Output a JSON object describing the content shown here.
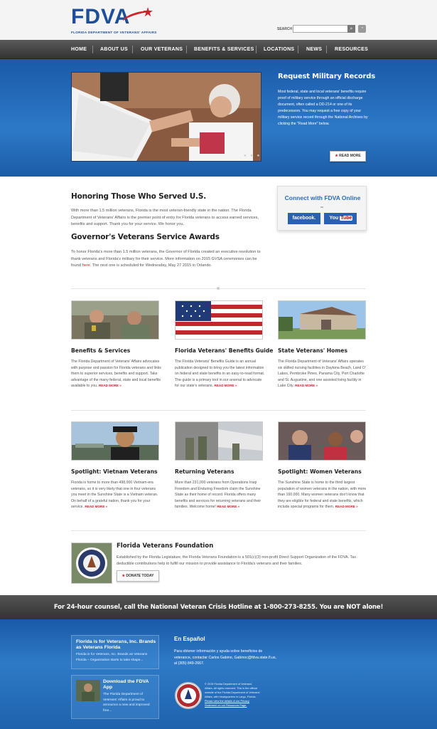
{
  "header": {
    "logo_text": "FDVA",
    "logo_subtitle": "FLORIDA DEPARTMENT OF VETERANS' AFFAIRS",
    "search_label": "SEARCH",
    "search_value": ""
  },
  "nav": [
    "HOME",
    "ABOUT US",
    "OUR VETERANS",
    "BENEFITS & SERVICES",
    "LOCATIONS",
    "NEWS",
    "RESOURCES"
  ],
  "hero": {
    "title": "Request Military Records",
    "text": "Most federal, state and local veterans' benefits require proof of military service through an official discharge document, often called a DD-214 or one of its predecessors. You may request a free copy of your military service record through the National Archives by clicking the \"Read More\" below.",
    "read_more": "READ MORE",
    "slider_dots": "● ● ●"
  },
  "intro": {
    "title": "Honoring Those Who Served U.S.",
    "text": "With more than 1.5 million veterans, Florida is the most veteran-friendly state in the nation. The Florida Department of Veterans' Affairs is the premier point of entry for Florida veterans to access earned services, benefits and support. Thank you for your service. We honor you.",
    "awards_title": "Governor's Veterans Service Awards",
    "awards_text_1": "To honor Florida's more than 1.5 million veterans, the Governor of Florida created an executive resolution to thank veterans and Florida's military for their service. More information on 2015 GVSA ceremonies can be found ",
    "awards_link": "here",
    "awards_text_2": ". The next one is scheduled for Wednesday, May 27 2015 in Orlando."
  },
  "connect": {
    "title": "Connect with FDVA Online",
    "facebook": "facebook.",
    "youtube_1": "You",
    "youtube_2": "Tube"
  },
  "cards_row1": [
    {
      "title": "Benefits & Services",
      "text": "The Florida Department of Veterans' Affairs advocates with purpose and passion for Florida veterans and links them to superior services, benefits and support. Take advantage of the many federal, state and local benefits available to you.",
      "link": "READ MORE »"
    },
    {
      "title": "Florida Veterans' Benefits Guide",
      "text": "The Florida Veterans' Benefits Guide is an annual publication designed to bring you the latest information on federal and state benefits in an easy-to-read format. The guide is a primary tool in our arsenal to advocate for our state's veterans.",
      "link": "READ MORE »"
    },
    {
      "title": "State Veterans' Homes",
      "text": "The Florida Department of Veterans' Affairs operates six skilled nursing facilities in Daytona Beach, Land O' Lakes, Pembroke Pines, Panama City, Port Charlotte and St. Augustine, and one assisted living facility in Lake City.",
      "link": "READ MORE »"
    }
  ],
  "cards_row2": [
    {
      "title": "Spotlight: Vietnam Veterans",
      "text": "Florida is home to more than 498,000 Vietnam-era veterans, so it is very likely that one in four veterans you meet in the Sunshine State is a Vietnam veteran. On behalf of a grateful nation, thank you for your service.",
      "link": "READ MORE »"
    },
    {
      "title": "Returning Veterans",
      "text": "More than 231,000 veterans from Operations Iraqi Freedom and Enduring Freedom claim the Sunshine State as their home of record. Florida offers many benefits and services for returning veterans and their families. Welcome home!",
      "link": "READ MORE »"
    },
    {
      "title": "Spotlight: Women Veterans",
      "text": "The Sunshine State is home to the third largest population of women veterans in the nation, with more than 160,000. Many women veterans don't know that they are eligible for federal and state benefits, which include special programs for them.",
      "link": "READ MORE »"
    }
  ],
  "foundation": {
    "title": "Florida Veterans Foundation",
    "text": "Established by the Florida Legislature, the Florida Veterans Foundation is a 501(c)(3) non-profit Direct Support Organization of the FDVA. Tax deductible contributions help to fulfill our mission to provide assistance to Florida's veterans and their families.",
    "donate": "DONATE TODAY"
  },
  "crisis_text": "For 24-hour counsel, call the National Veteran Crisis Hotline at 1-800-273-8255. You are NOT alone!",
  "footer": {
    "box1_title": "Florida is for Veterans, Inc. Brands as Veterans Florida",
    "box1_text": "Florida is for Veterans, Inc. Brands as Veterans Florida – Organization starts to take shape...",
    "box2_title": "Download the FDVA App",
    "box2_text": "The Florida Department of Veterans' Affairs is proud to announce a new and improved free...",
    "espanol_title": "En Español",
    "espanol_text": "Para obtener información y ayuda sobre beneficios de veterance, contactar Carlos Gabino, Gabinoc@fdva.state.fl.us, al (305) 849-2667.",
    "copyright": "© 2015 Florida Department of Veterans' Affairs. All rights reserved. This is the official website of the Florida Department of Veterans' Affairs, with headquarters in Largo, Florida.",
    "privacy": "Please view the details of our Privacy Statement on our Resources Page."
  },
  "colors": {
    "brand_blue": "#1d4e9a",
    "accent_red": "#d2232a",
    "hero_blue": "#2d79c8"
  }
}
